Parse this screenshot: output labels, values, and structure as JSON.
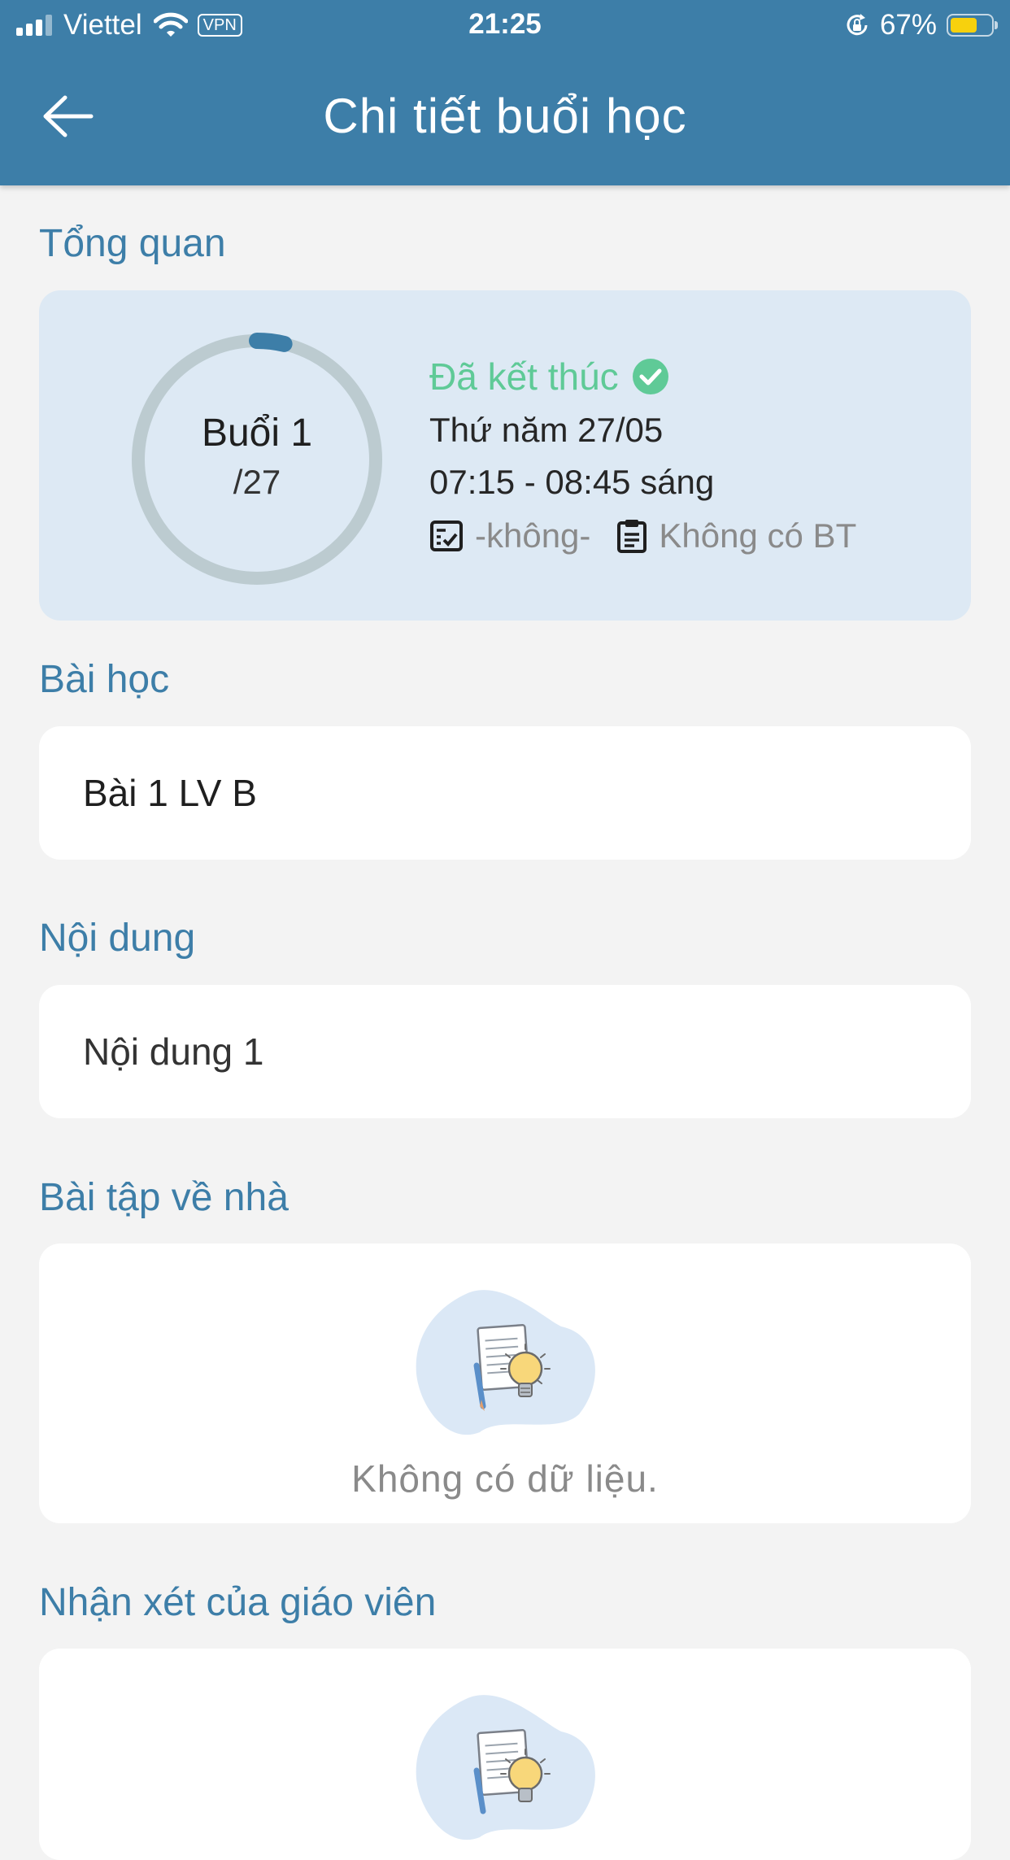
{
  "status_bar": {
    "carrier": "Viettel",
    "vpn": "VPN",
    "time": "21:25",
    "battery_percent": "67%",
    "battery_level": 0.67,
    "signal_bars": 3
  },
  "header": {
    "title": "Chi tiết buổi học",
    "back_icon": "arrow-left-icon"
  },
  "overview": {
    "section_title": "Tổng quan",
    "session_label": "Buổi 1",
    "session_total": "/27",
    "progress": 0.037,
    "status": "Đã kết thúc",
    "status_color": "#5fca97",
    "day_date": "Thứ năm 27/05",
    "time_range": "07:15 - 08:45 sáng",
    "attendance": "-không-",
    "homework": "Không có BT"
  },
  "lesson": {
    "section_title": "Bài học",
    "value": "Bài 1 LV B"
  },
  "content": {
    "section_title": "Nội dung",
    "value": "Nội dung 1"
  },
  "homework": {
    "section_title": "Bài tập về nhà",
    "empty_text": "Không có dữ liệu."
  },
  "teacher_comment": {
    "section_title": "Nhận xét của giáo viên"
  },
  "colors": {
    "primary": "#3d7ea8",
    "overview_bg": "#dde9f4",
    "ring_track": "#bccbd0",
    "success": "#5fca97"
  }
}
